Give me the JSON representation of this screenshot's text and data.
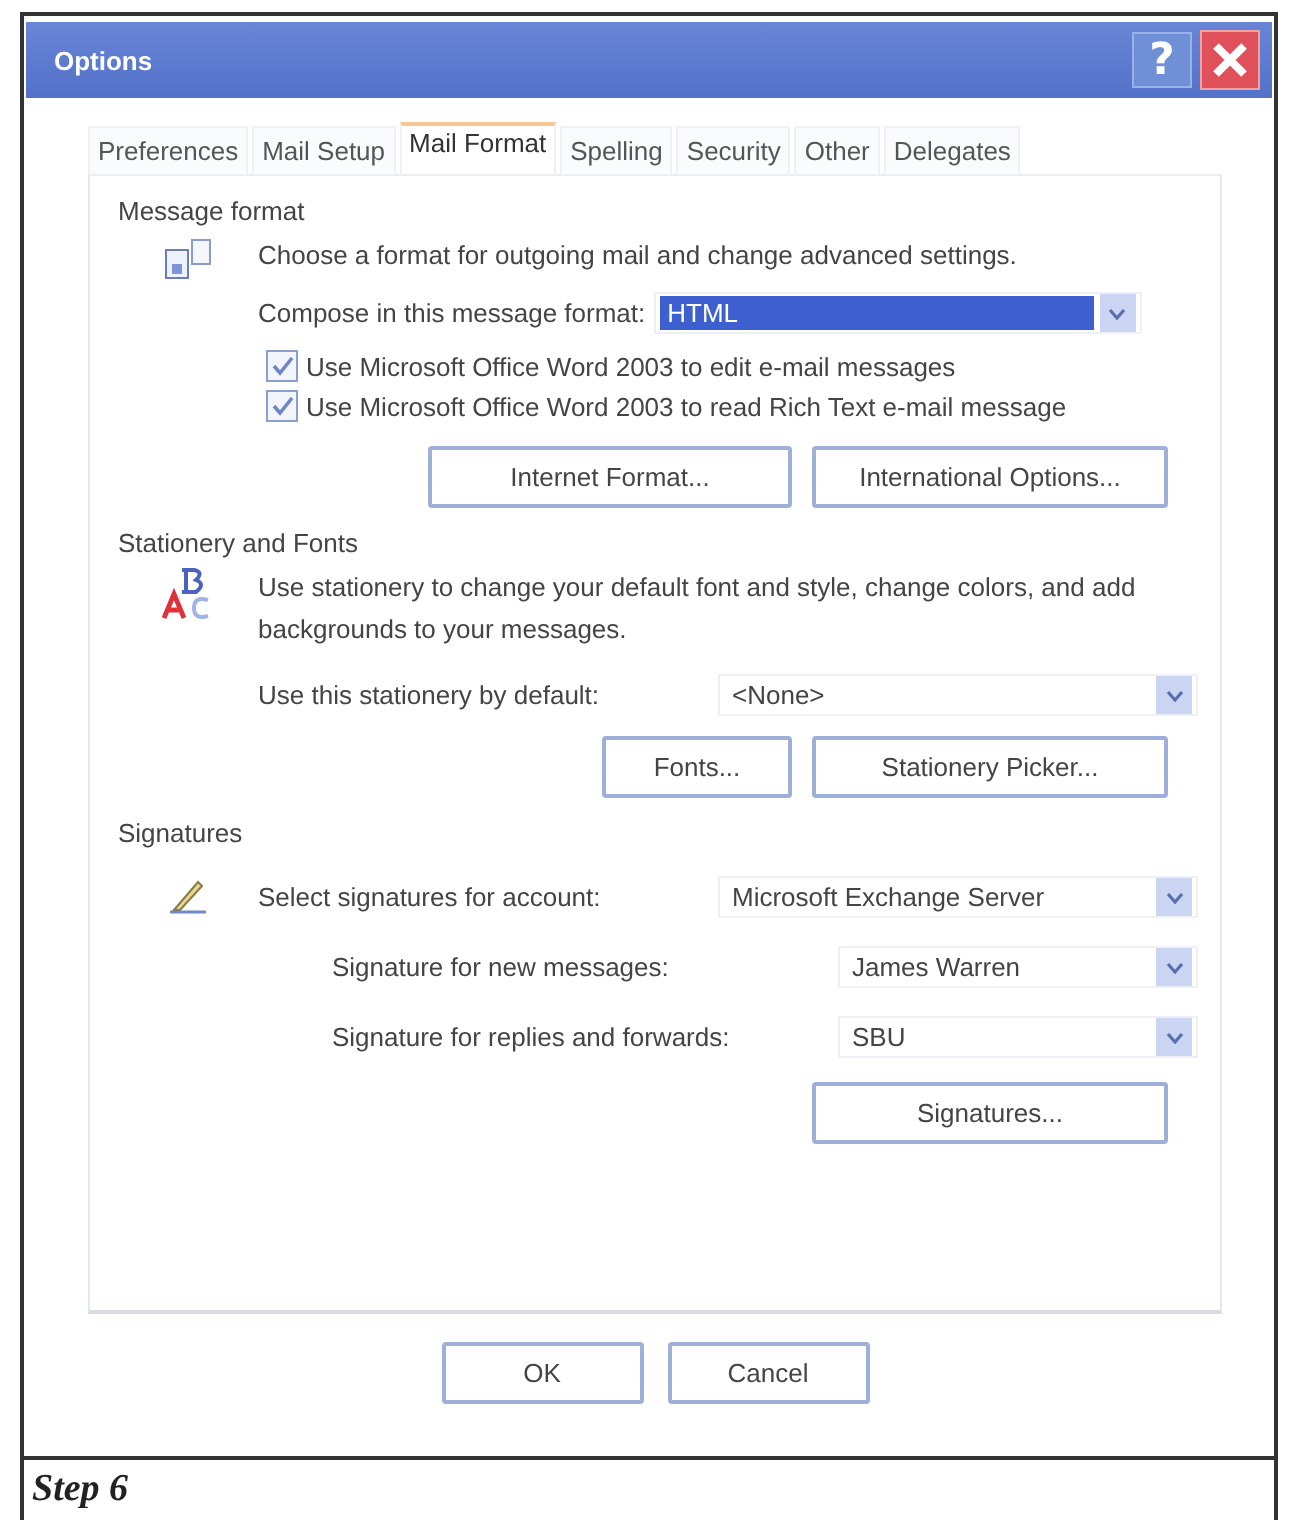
{
  "window": {
    "title": "Options",
    "help_button": "?"
  },
  "tabs": [
    {
      "label": "Preferences",
      "selected": false
    },
    {
      "label": "Mail Setup",
      "selected": false
    },
    {
      "label": "Mail Format",
      "selected": true
    },
    {
      "label": "Spelling",
      "selected": false
    },
    {
      "label": "Security",
      "selected": false
    },
    {
      "label": "Other",
      "selected": false
    },
    {
      "label": "Delegates",
      "selected": false
    }
  ],
  "message_format": {
    "heading": "Message format",
    "description": "Choose a format for outgoing mail and change advanced settings.",
    "compose": {
      "label": "Compose in this message format:",
      "value": "HTML",
      "focused": true
    },
    "checkboxes": [
      {
        "label": "Use Microsoft Office Word 2003 to edit e-mail messages",
        "checked": true
      },
      {
        "label": "Use Microsoft Office Word 2003 to read Rich Text e-mail message",
        "checked": true
      }
    ],
    "buttons": [
      "Internet Format...",
      "International Options..."
    ]
  },
  "stationery_and_fonts": {
    "heading": "Stationery and Fonts",
    "description": "Use stationery to change your default font and style, change colors, and add backgrounds to your messages.",
    "stationery": {
      "label": "Use this stationery by default:",
      "value": "<None>",
      "focused": false
    },
    "buttons": [
      "Fonts...",
      "Stationery Picker..."
    ]
  },
  "signatures": {
    "heading": "Signatures",
    "account": {
      "label": "Select signatures for account:",
      "value": "Microsoft Exchange Server",
      "focused": false
    },
    "new_messages": {
      "label": "Signature for new messages:",
      "value": "James Warren",
      "focused": false
    },
    "replies": {
      "label": "Signature for replies and forwards:",
      "value": "SBU",
      "focused": false
    },
    "buttons": [
      "Signatures..."
    ]
  },
  "dialog_buttons": [
    "OK",
    "Cancel"
  ],
  "caption": "Step 6"
}
